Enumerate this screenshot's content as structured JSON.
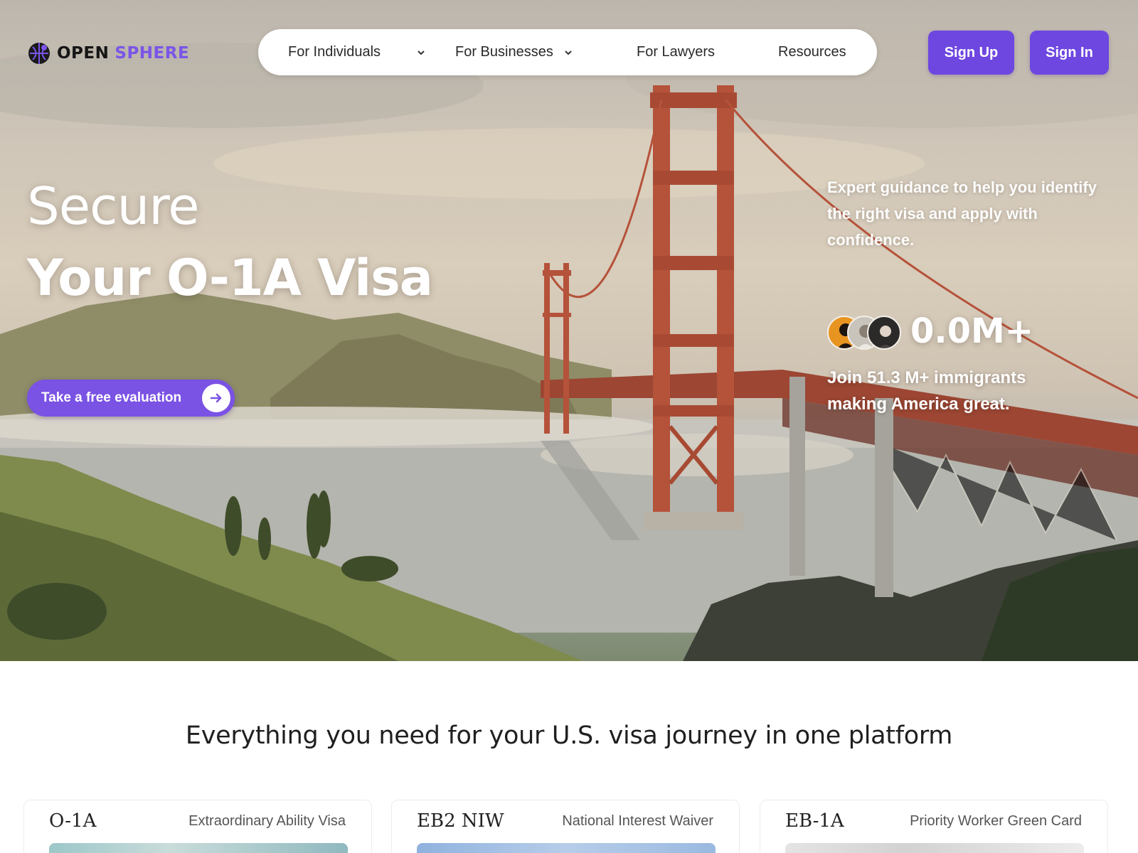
{
  "brand": {
    "part1": "OPEN",
    "part2": "SPHERE"
  },
  "nav": {
    "items": [
      {
        "label": "For Individuals",
        "dropdown": true
      },
      {
        "label": "For Businesses",
        "dropdown": true
      },
      {
        "label": "For Lawyers",
        "dropdown": false
      },
      {
        "label": "Resources",
        "dropdown": false
      }
    ]
  },
  "auth": {
    "signup": "Sign Up",
    "signin": "Sign In"
  },
  "hero": {
    "line1": "Secure",
    "line2": "Your O-1A Visa",
    "cta": "Take a free evaluation",
    "tagline": "Expert guidance to help you identify the right visa and apply with confidence.",
    "stat": "0.0M+",
    "join": "Join 51.3 M+ immigrants making America great."
  },
  "section": {
    "title": "Everything you need for your U.S. visa journey in one platform",
    "cards": [
      {
        "code": "O-1A",
        "name": "Extraordinary Ability Visa"
      },
      {
        "code": "EB2 NIW",
        "name": "National Interest Waiver"
      },
      {
        "code": "EB-1A",
        "name": "Priority Worker Green Card"
      }
    ]
  },
  "colors": {
    "accent": "#6e47e0",
    "brand_purple": "#7b55e8",
    "bridge": "#b5523a"
  },
  "icons": [
    "globe-logo-icon",
    "chevron-down-icon",
    "arrow-right-icon"
  ]
}
